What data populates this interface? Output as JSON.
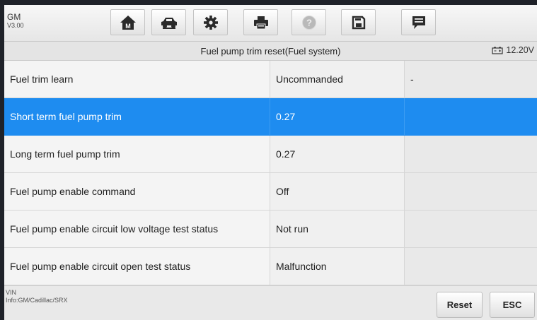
{
  "app": {
    "name": "GM",
    "version": "V3.00"
  },
  "toolbar": {
    "icons": [
      "home-icon",
      "vehicle-icon",
      "settings-icon",
      "print-icon",
      "help-icon",
      "save-icon",
      "message-icon"
    ]
  },
  "header": {
    "title": "Fuel pump trim reset(Fuel system)",
    "voltage": "12.20V"
  },
  "table": {
    "rows": [
      {
        "name": "Fuel trim learn",
        "value": "Uncommanded",
        "unit": "-"
      },
      {
        "name": "Short term fuel pump trim",
        "value": "0.27",
        "unit": ""
      },
      {
        "name": "Long term fuel pump trim",
        "value": "0.27",
        "unit": ""
      },
      {
        "name": "Fuel pump enable command",
        "value": "Off",
        "unit": ""
      },
      {
        "name": "Fuel pump enable circuit low voltage test status",
        "value": "Not run",
        "unit": ""
      },
      {
        "name": "Fuel pump enable circuit open test status",
        "value": "Malfunction",
        "unit": ""
      }
    ],
    "selected_index": 1
  },
  "footer": {
    "vin_label": "VIN",
    "info": "Info:GM/Cadillac/SRX",
    "reset_label": "Reset",
    "esc_label": "ESC"
  },
  "colors": {
    "selected": "#1e8cf0",
    "accent_dark": "#222222"
  }
}
